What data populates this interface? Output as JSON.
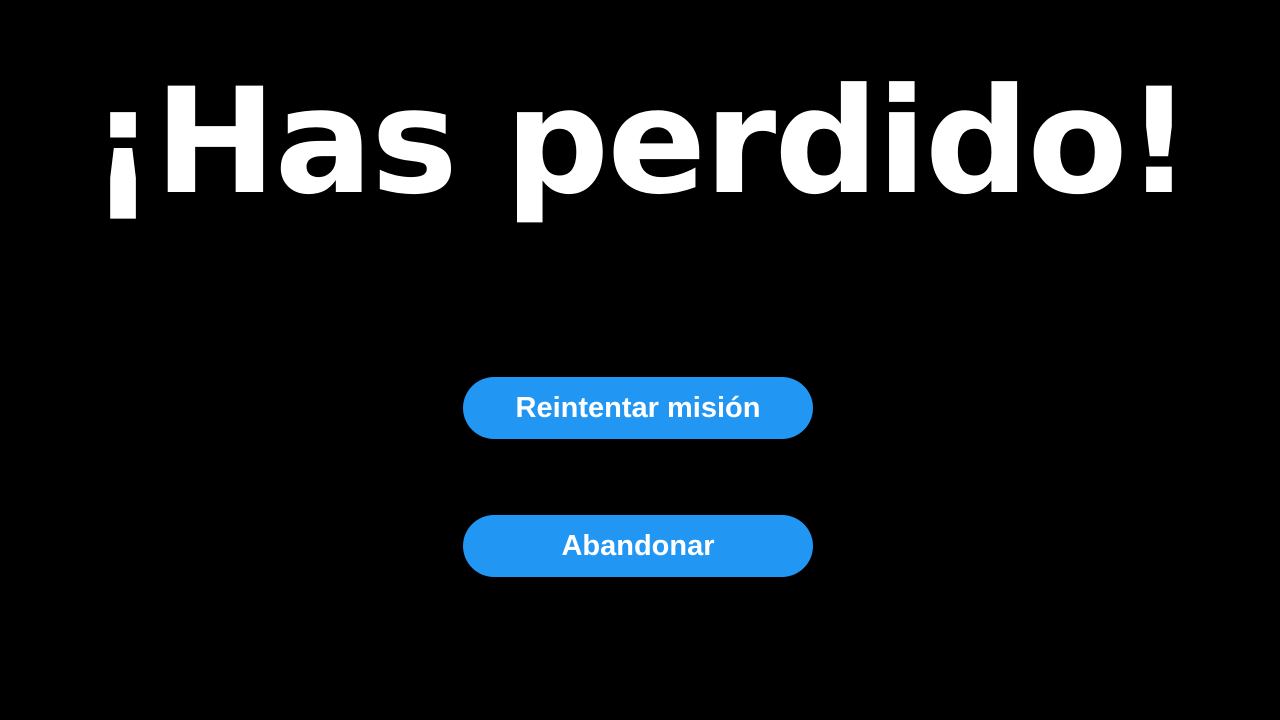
{
  "title": "¡Has perdido!",
  "buttons": {
    "retry_label": "Reintentar misión",
    "abandon_label": "Abandonar"
  },
  "colors": {
    "background": "#000000",
    "title": "#ffffff",
    "button": "#2196f3",
    "button_text": "#ffffff"
  }
}
